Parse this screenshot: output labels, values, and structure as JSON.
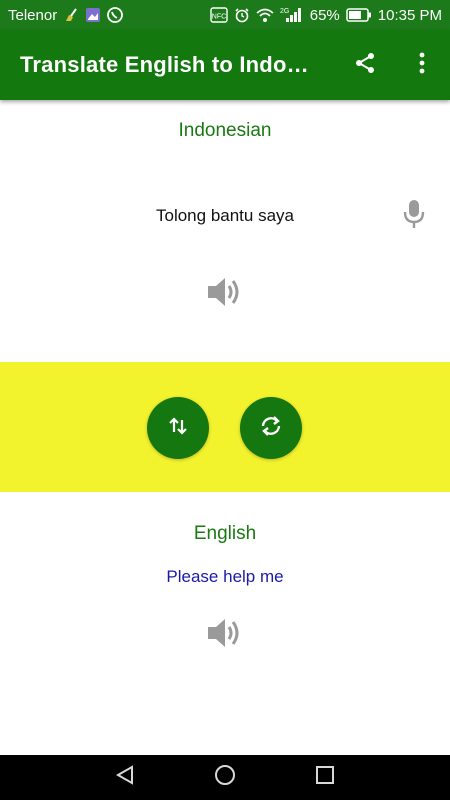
{
  "status_bar": {
    "carrier": "Telenor",
    "network": "2G",
    "battery": "65%",
    "time": "10:35 PM",
    "nfc": "NFC"
  },
  "app_bar": {
    "title": "Translate English to Indo…",
    "share_icon": "share-icon",
    "menu_icon": "more-vertical-icon",
    "color": "#13790e"
  },
  "source": {
    "language": "Indonesian",
    "text": "Tolong bantu saya",
    "mic_icon": "microphone-icon",
    "speaker_icon": "speaker-icon"
  },
  "controls": {
    "band_color": "#f2f22d",
    "swap_icon": "swap-vertical-icon",
    "refresh_icon": "refresh-icon"
  },
  "target": {
    "language": "English",
    "text": "Please help me",
    "text_color": "#1a1aa8",
    "speaker_icon": "speaker-icon"
  },
  "nav_bar": {
    "back_icon": "back-triangle-icon",
    "home_icon": "home-circle-icon",
    "recents_icon": "recents-square-icon"
  }
}
